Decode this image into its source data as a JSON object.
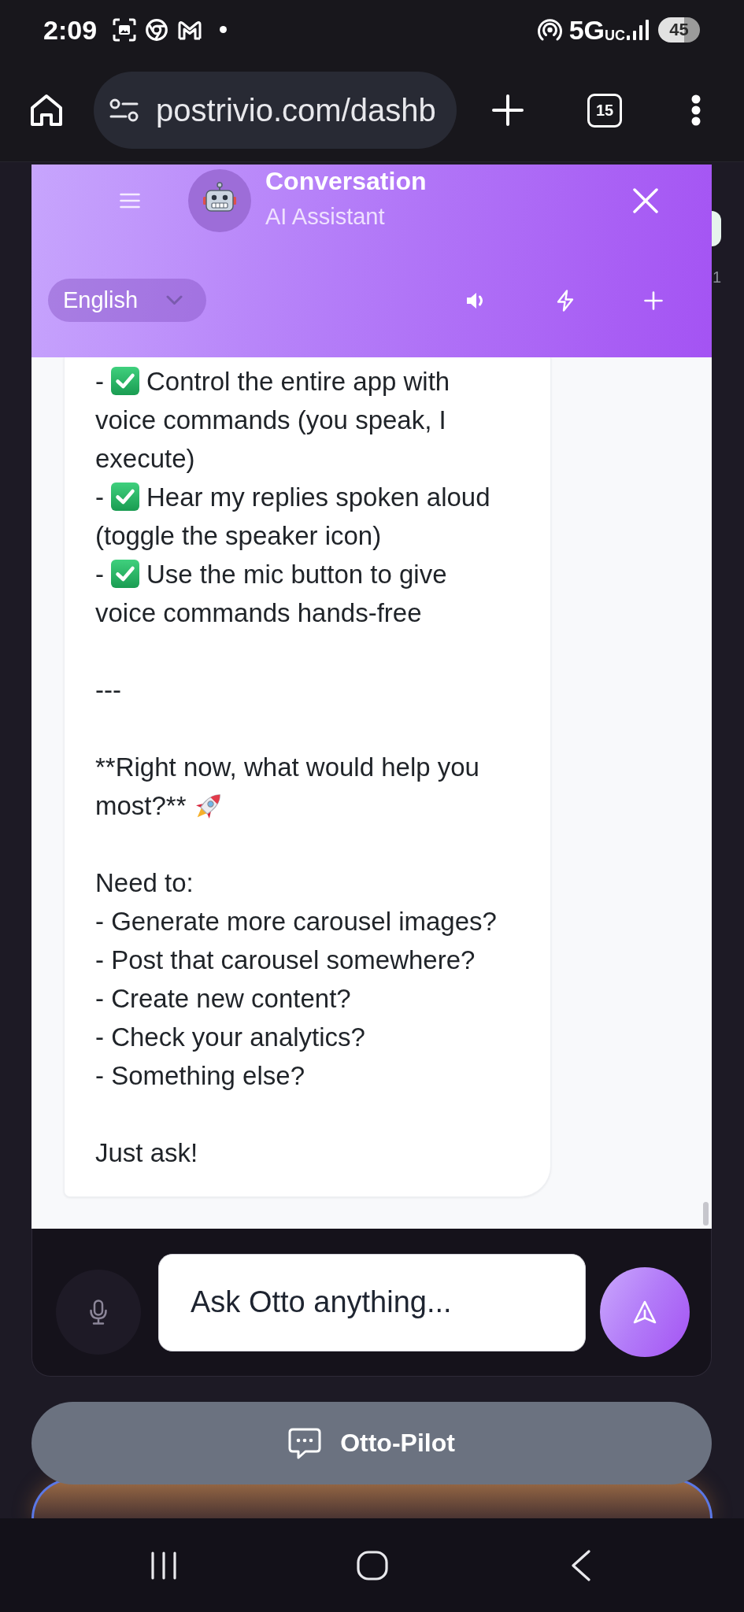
{
  "status_bar": {
    "time": "2:09",
    "network": "5G$_{UC}$",
    "battery": "45"
  },
  "browser": {
    "url": "postrivio.com/dashb",
    "tab_count": "15"
  },
  "chat": {
    "title": "Conversation",
    "subtitle": "AI Assistant",
    "language": "English",
    "message": {
      "blocks": [
        {
          "lines": [
            {
              "kind": "checklist",
              "prefix": "-",
              "text": "Control the entire app with voice commands (you speak, I execute)"
            },
            {
              "kind": "checklist",
              "prefix": "-",
              "text": "Hear my replies spoken aloud (toggle the speaker icon)"
            },
            {
              "kind": "checklist",
              "prefix": "-",
              "text": "Use the mic button to give voice commands hands-free"
            }
          ]
        },
        {
          "lines": [
            {
              "kind": "plain",
              "text": "---"
            }
          ]
        },
        {
          "lines": [
            {
              "kind": "callout",
              "text": "**Right now, what would help you most?**"
            }
          ]
        },
        {
          "lines": [
            {
              "kind": "plain",
              "text": "Need to:"
            },
            {
              "kind": "plain",
              "text": "- Generate more carousel images?"
            },
            {
              "kind": "plain",
              "text": "- Post that carousel somewhere?"
            },
            {
              "kind": "plain",
              "text": "- Create new content?"
            },
            {
              "kind": "plain",
              "text": "- Check your analytics?"
            },
            {
              "kind": "plain",
              "text": "- Something else?"
            }
          ]
        },
        {
          "lines": [
            {
              "kind": "plain",
              "text": "Just ask!"
            }
          ]
        }
      ]
    },
    "composer": {
      "placeholder": "Ask Otto anything..."
    }
  },
  "otto_pilot": {
    "label": "Otto-Pilot"
  },
  "background_page": {
    "edge_text": "1"
  }
}
